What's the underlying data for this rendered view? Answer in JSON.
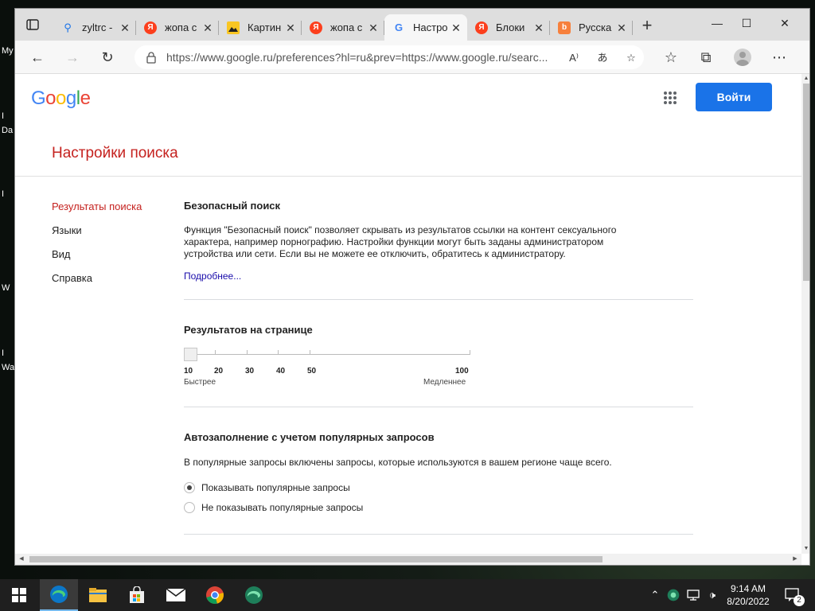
{
  "desktop": {
    "labels": [
      "My",
      "I",
      "Da",
      "I",
      "W",
      "I",
      "Wa"
    ]
  },
  "browser": {
    "tabs": [
      {
        "title": "zyltrc -",
        "favicon": "search-icon"
      },
      {
        "title": "жопа с",
        "favicon": "yandex-icon"
      },
      {
        "title": "Картин",
        "favicon": "image-icon"
      },
      {
        "title": "жопа с",
        "favicon": "yandex-icon"
      },
      {
        "title": "Настро",
        "favicon": "google-icon"
      },
      {
        "title": "Блоки",
        "favicon": "yandex-icon"
      },
      {
        "title": "Русска",
        "favicon": "bing-icon"
      }
    ],
    "url": "https://www.google.ru/preferences?hl=ru&prev=https://www.google.ru/searc..."
  },
  "page": {
    "logo": "Google",
    "signin_label": "Войти",
    "title": "Настройки поиска",
    "nav": [
      "Результаты поиска",
      "Языки",
      "Вид",
      "Справка"
    ],
    "safe_search": {
      "title": "Безопасный поиск",
      "lines": [
        "Функция \"Безопасный поиск\" позволяет скрывать из результатов ссылки на контент сексуального",
        "характера, например порнографию. Настройки функции могут быть заданы администратором",
        "устройства или сети. Если вы не можете ее отключить, обратитесь к администратору."
      ],
      "more_link": "Подробнее..."
    },
    "results_per_page": {
      "title": "Результатов на странице",
      "ticks": [
        "10",
        "20",
        "30",
        "40",
        "50",
        "100"
      ],
      "value": "10",
      "faster": "Быстрее",
      "slower": "Медленнее"
    },
    "autocomplete": {
      "title": "Автозаполнение с учетом популярных запросов",
      "description": "В популярные запросы включены запросы, которые используются в вашем регионе чаще всего.",
      "options": [
        "Показывать популярные запросы",
        "Не показывать популярные запросы"
      ],
      "selected": 0
    }
  },
  "taskbar": {
    "time": "9:14 AM",
    "date": "8/20/2022",
    "notification_count": "2"
  },
  "colors": {
    "accent_red": "#c5221f",
    "signin_blue": "#1a73e8",
    "link": "#1a0dab"
  }
}
